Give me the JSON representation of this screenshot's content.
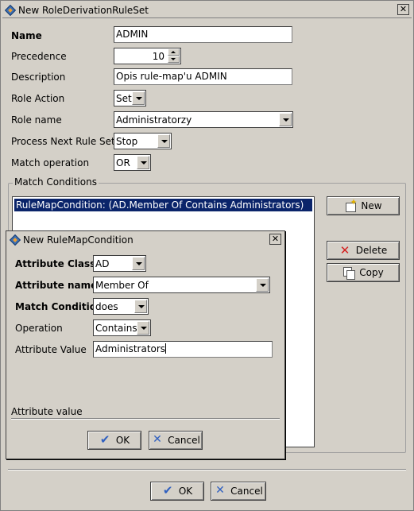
{
  "main_window": {
    "title": "New RoleDerivationRuleSet",
    "close_glyph": "✕",
    "labels": {
      "name": "Name",
      "precedence": "Precedence",
      "description": "Description",
      "role_action": "Role Action",
      "role_name": "Role name",
      "process_next_rule_set": "Process Next Rule Set",
      "match_operation": "Match operation"
    },
    "values": {
      "name": "ADMIN",
      "precedence": "10",
      "description": "Opis rule-map'u ADMIN",
      "role_action": "Set",
      "role_name": "Administratorzy",
      "process_next_rule_set": "Stop",
      "match_operation": "OR"
    },
    "match_conditions": {
      "title": "Match Conditions",
      "items": [
        "RuleMapCondition: (AD.Member Of Contains Administrators)"
      ],
      "new_label": "New",
      "delete_label": "Delete",
      "copy_label": "Copy"
    },
    "ok_label": "OK",
    "cancel_label": "Cancel"
  },
  "condition_dialog": {
    "title": "New RuleMapCondition",
    "close_glyph": "✕",
    "labels": {
      "attribute_class": "Attribute Class",
      "attribute_name": "Attribute name",
      "match_condition": "Match Condition",
      "operation": "Operation",
      "attribute_value": "Attribute Value"
    },
    "values": {
      "attribute_class": "AD",
      "attribute_name": "Member Of",
      "match_condition": "does",
      "operation": "Contains",
      "attribute_value": "Administrators"
    },
    "help_text": "Attribute value",
    "ok_label": "OK",
    "cancel_label": "Cancel"
  },
  "icons": [
    "app-icon",
    "close-icon",
    "new-icon",
    "delete-icon",
    "copy-icon",
    "ok-icon",
    "cancel-icon",
    "dropdown-arrow-icon",
    "spinner-up-icon",
    "spinner-down-icon"
  ],
  "colors": {
    "window_bg": "#d4d0c8",
    "selection_bg": "#0a246a",
    "selection_fg": "#ffffff",
    "accent_icon": "#3060c0",
    "delete_red": "#d42020"
  }
}
